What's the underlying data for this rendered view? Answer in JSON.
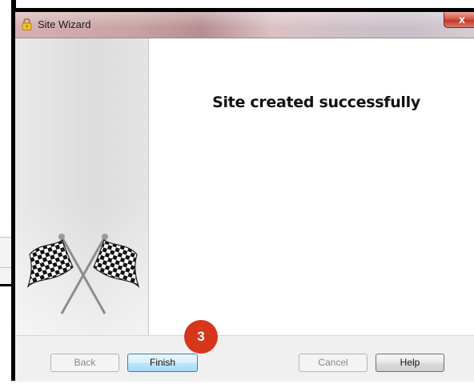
{
  "window": {
    "title": "Site Wizard",
    "close_glyph": "x",
    "app_icon": "padlock-icon",
    "close_icon": "close-icon"
  },
  "side_panel": {
    "image": "checkered-flags-icon"
  },
  "content": {
    "message": "Site created successfully"
  },
  "buttons": {
    "back": "Back",
    "finish": "Finish",
    "cancel": "Cancel",
    "help": "Help"
  },
  "annotation": {
    "step_number": "3",
    "color": "#d5361c"
  }
}
